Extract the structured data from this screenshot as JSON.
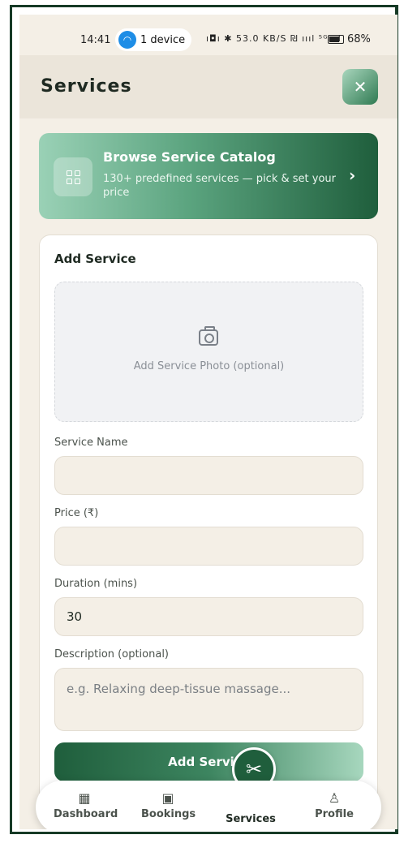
{
  "status": {
    "time": "14:41",
    "hotspot": "1 device",
    "sys_icons": "ı◘ı ✱ 53.0 KB/S ₪ ıııl ⁵ᴳıııl",
    "battery": "68%"
  },
  "header": {
    "title": "Services"
  },
  "catalog": {
    "title": "Browse Service Catalog",
    "subtitle": "130+ predefined services — pick & set your price"
  },
  "form": {
    "title": "Add Service",
    "photo_label": "Add Service Photo (optional)",
    "service_name_label": "Service Name",
    "service_name_value": "",
    "price_label": "Price (₹)",
    "price_value": "",
    "duration_label": "Duration (mins)",
    "duration_value": "30",
    "description_label": "Description (optional)",
    "description_placeholder": "e.g. Relaxing deep-tissue massage...",
    "submit_label": "Add Service"
  },
  "nav": {
    "items": [
      {
        "label": "Dashboard",
        "icon": "dashboard-icon"
      },
      {
        "label": "Bookings",
        "icon": "calendar-icon"
      },
      {
        "label": "Services",
        "icon": "scissors-icon"
      },
      {
        "label": "Profile",
        "icon": "user-icon"
      }
    ]
  },
  "colors": {
    "accent": "#1f5e3c",
    "background": "#f4efe6"
  }
}
